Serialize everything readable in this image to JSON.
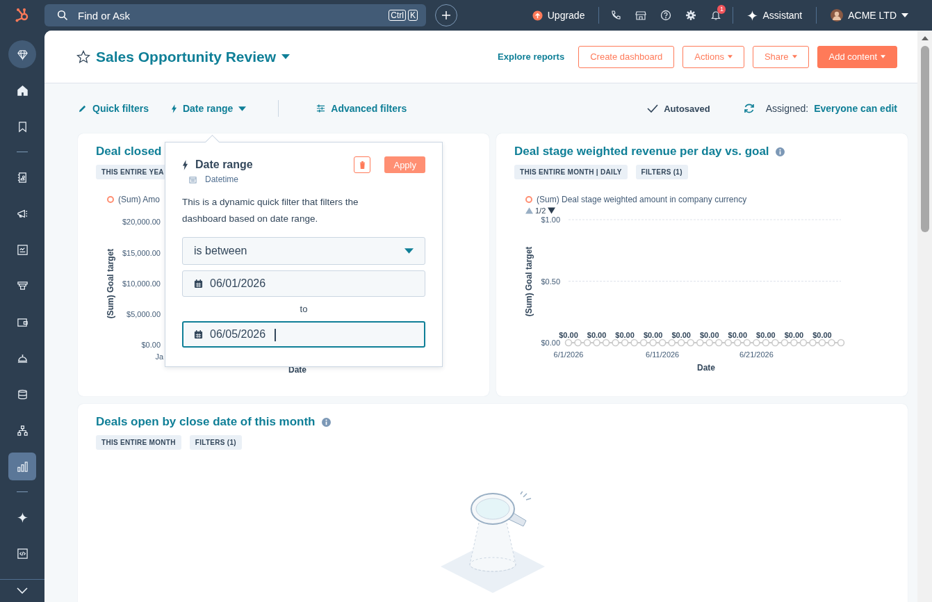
{
  "topbar": {
    "search": {
      "placeholder": "Find or Ask",
      "keys": [
        "Ctrl",
        "K"
      ]
    },
    "upgrade": "Upgrade",
    "notifications": "1",
    "assistant": "Assistant",
    "account": "ACME LTD"
  },
  "sidebar": {
    "items": [
      {
        "kind": "diamond",
        "selected": false
      },
      {
        "kind": "home",
        "selected": false
      },
      {
        "kind": "bookmark",
        "selected": false
      },
      {
        "kind": "divider"
      },
      {
        "kind": "contacts",
        "selected": false
      },
      {
        "kind": "megaphone",
        "selected": false
      },
      {
        "kind": "content",
        "selected": false
      },
      {
        "kind": "commerce",
        "selected": false
      },
      {
        "kind": "wallet",
        "selected": false
      },
      {
        "kind": "service",
        "selected": false
      },
      {
        "kind": "database",
        "selected": false
      },
      {
        "kind": "hierarchy",
        "selected": false
      },
      {
        "kind": "reports",
        "selected": true
      },
      {
        "kind": "divider"
      },
      {
        "kind": "sparkle",
        "selected": false
      },
      {
        "kind": "code",
        "selected": false
      }
    ]
  },
  "dashboard": {
    "title": "Sales Opportunity Review",
    "favorite": false,
    "explore": "Explore reports",
    "buttons": [
      {
        "label": "Create dashboard",
        "kind": "outline",
        "caret": false
      },
      {
        "label": "Actions",
        "kind": "outline",
        "caret": true
      },
      {
        "label": "Share",
        "kind": "outline",
        "caret": true
      },
      {
        "label": "Add content",
        "kind": "primary",
        "caret": true
      }
    ]
  },
  "filter_bar": {
    "quick_filters": "Quick filters",
    "date_range": {
      "label": "Date range",
      "expanded": true
    },
    "advanced_filters": "Advanced filters",
    "autosaved": "Autosaved",
    "assigned_label": "Assigned:",
    "assigned_value": "Everyone can edit"
  },
  "popover": {
    "title": "Date range",
    "type": "Datetime",
    "apply": "Apply",
    "description": "This is a dynamic quick filter that filters the dashboard based on date range.",
    "operator": "is between",
    "from": {
      "value": "06/01/2026",
      "focused": false
    },
    "separator": "to",
    "to": {
      "value": "06/05/2026",
      "focused": true
    }
  },
  "cards": [
    {
      "title": "Deal closed",
      "tags": [
        "THIS ENTIRE YEA"
      ],
      "legend": "(Sum) Amo",
      "yticks": [
        "$20,000.00",
        "$15,000.00",
        "$10,000.00",
        "$5,000.00",
        "$0.00"
      ],
      "xtick": "Ja",
      "ylabel": "(Sum) Goal target",
      "xlabel": "Date"
    },
    {
      "title": "Deal stage weighted revenue per day vs. goal",
      "tags": [
        "THIS ENTIRE MONTH | DAILY",
        "FILTERS (1)"
      ],
      "pager": "1/2",
      "chart_data": {
        "type": "line",
        "xlabel": "Date",
        "ylabel": "(Sum) Goal target",
        "categories": [
          "6/1/2026",
          null,
          null,
          null,
          null,
          null,
          null,
          null,
          null,
          null,
          "6/11/2026",
          null,
          null,
          null,
          null,
          null,
          null,
          null,
          null,
          null,
          "6/21/2026",
          null,
          null,
          null,
          null,
          null,
          null,
          null,
          null,
          null
        ],
        "series": [
          {
            "name": "(Sum) Deal stage weighted amount in company currency",
            "color": "#cbcbcb",
            "marker": "circle",
            "values": [
              0,
              0,
              0,
              0,
              0,
              0,
              0,
              0,
              0,
              0,
              0,
              0,
              0,
              0,
              0,
              0,
              0,
              0,
              0,
              0,
              0,
              0,
              0,
              0,
              0,
              0,
              0,
              0,
              0,
              0
            ]
          }
        ],
        "ylim": [
          0,
          1
        ],
        "yticks": [
          {
            "value": 0,
            "label": "$0.00"
          },
          {
            "value": 0.5,
            "label": "$0.50"
          },
          {
            "value": 1,
            "label": "$1.00"
          }
        ],
        "value_labels": [
          "$0.00",
          null,
          null,
          "$0.00",
          null,
          null,
          "$0.00",
          null,
          null,
          "$0.00",
          null,
          null,
          "$0.00",
          null,
          null,
          "$0.00",
          null,
          null,
          "$0.00",
          null,
          null,
          "$0.00",
          null,
          null,
          "$0.00",
          null,
          null,
          "$0.00",
          null,
          null
        ]
      }
    },
    {
      "title": "Deals open by close date of this month",
      "tags": [
        "THIS ENTIRE MONTH",
        "FILTERS (1)"
      ]
    }
  ]
}
